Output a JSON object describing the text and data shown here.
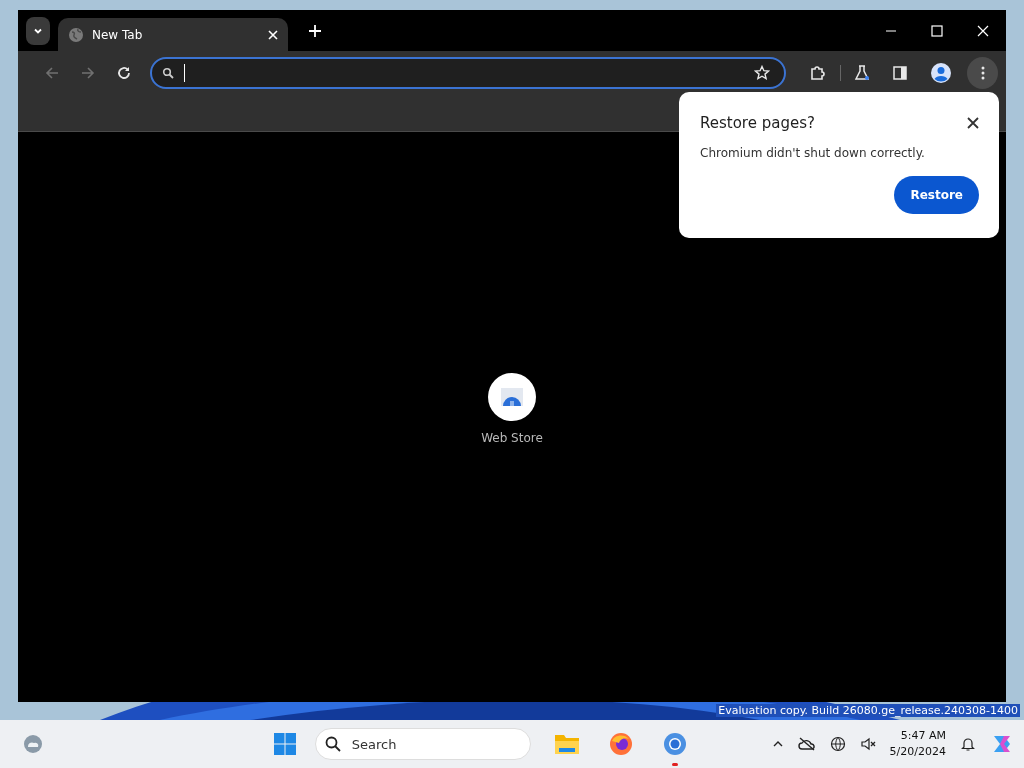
{
  "tabs": [
    {
      "title": "New Tab",
      "selected": true
    }
  ],
  "navigation": {
    "back_disabled": true,
    "forward_disabled": true
  },
  "omnibox": {
    "focused": true
  },
  "shortcuts": [
    {
      "label": "Web Store"
    }
  ],
  "dialog": {
    "title": "Restore pages?",
    "message": "Chromium didn't shut down correctly.",
    "button": "Restore"
  },
  "desktop_notice": "Evaluation copy. Build 26080.ge_release.240308-1400",
  "taskbar": {
    "search_placeholder": "Search",
    "apps": [
      {
        "kind": "files",
        "selected": false
      },
      {
        "kind": "firefox",
        "selected": false
      },
      {
        "kind": "chromium",
        "selected": true
      }
    ],
    "time": "5:47 AM",
    "date": "5/20/2024"
  }
}
